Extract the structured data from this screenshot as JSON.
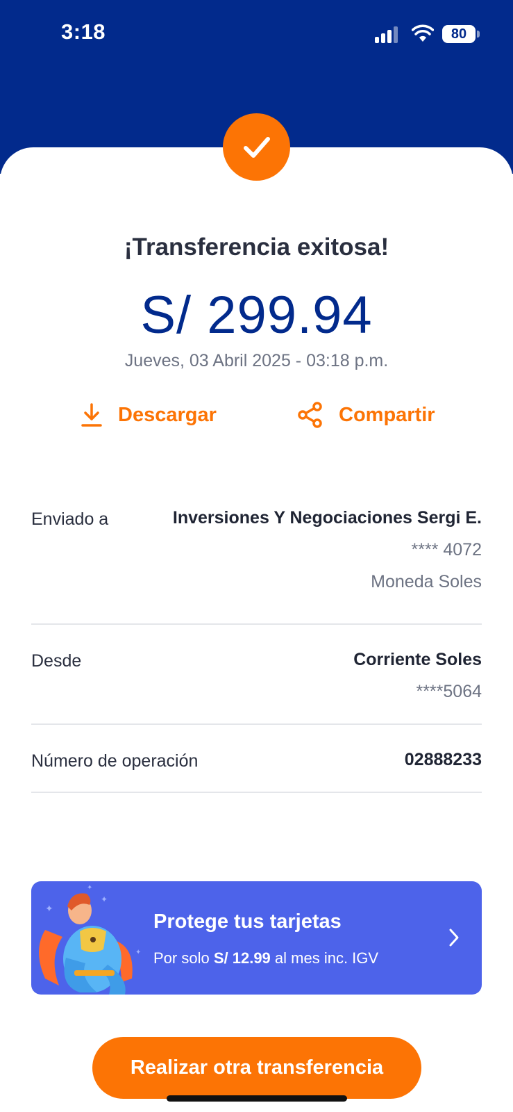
{
  "status_bar": {
    "time": "3:18",
    "battery": "80"
  },
  "header": {
    "title": "¡Transferencia exitosa!"
  },
  "transfer": {
    "amount": "S/ 299.94",
    "datetime": "Jueves, 03 Abril 2025 - 03:18 p.m."
  },
  "actions": {
    "download_label": "Descargar",
    "share_label": "Compartir"
  },
  "details": {
    "recipient": {
      "label": "Enviado a",
      "name": "Inversiones Y Negociaciones Sergi E.",
      "account": "**** 4072",
      "currency": "Moneda Soles"
    },
    "origin": {
      "label": "Desde",
      "account_type": "Corriente Soles",
      "account": "****5064"
    },
    "operation": {
      "label": "Número de operación",
      "number": "02888233"
    }
  },
  "promo": {
    "title": "Protege tus tarjetas",
    "subtitle_prefix": "Por solo",
    "price": "S/ 12.99",
    "subtitle_suffix": "al mes inc. IGV"
  },
  "cta": {
    "label": "Realizar otra transferencia"
  },
  "colors": {
    "brand_blue": "#022a8c",
    "accent_orange": "#fc7405",
    "promo_blue": "#4d63ea"
  },
  "icons": [
    "check-icon",
    "download-icon",
    "share-icon",
    "chevron-right-icon",
    "superhero-illustration",
    "signal-icon",
    "wifi-icon",
    "battery-icon"
  ]
}
